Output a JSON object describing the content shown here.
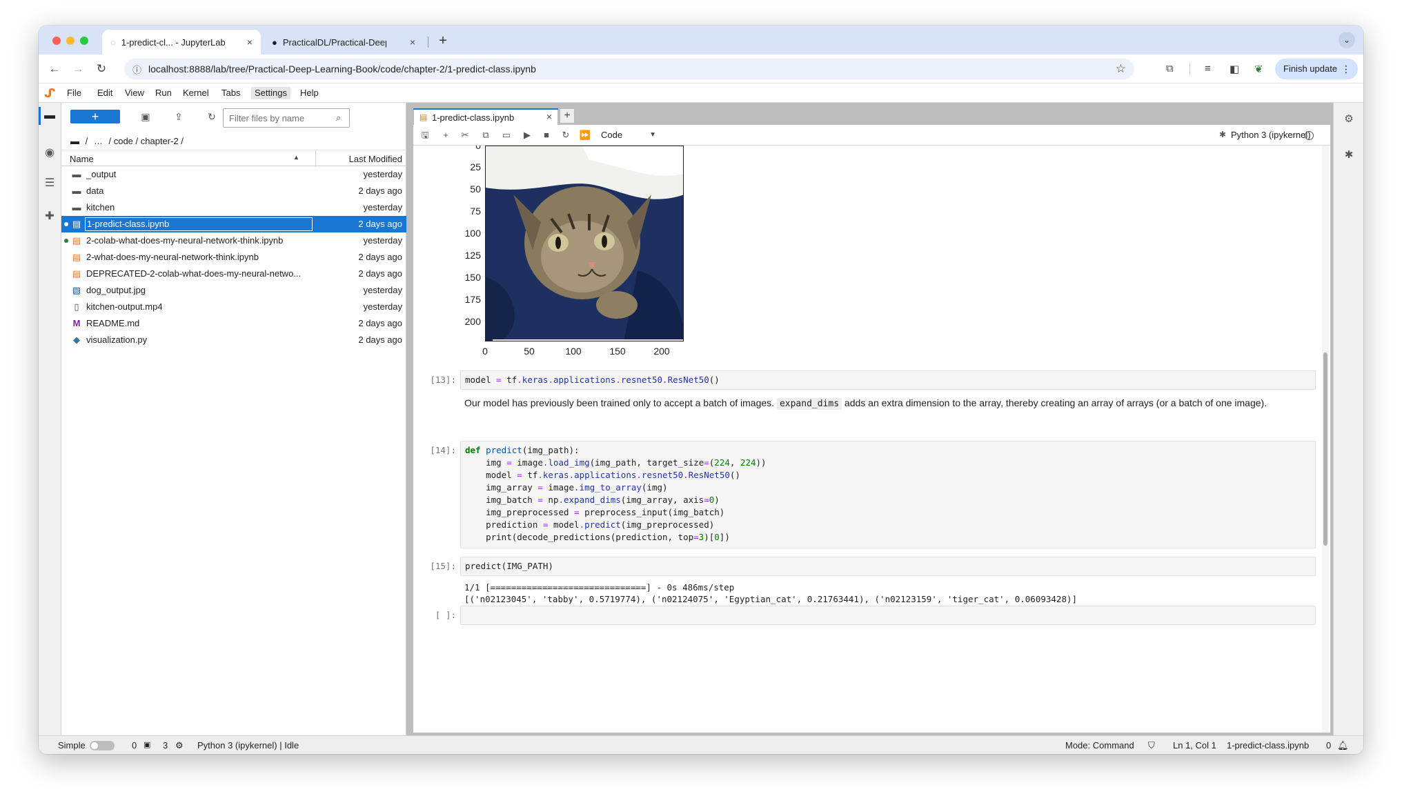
{
  "browser": {
    "tabs": [
      {
        "title": "1-predict-cl... - JupyterLab",
        "active": true
      },
      {
        "title": "PracticalDL/Practical-Deep-L",
        "active": false
      }
    ],
    "new_tab": "+",
    "tab_close": "×",
    "url": "localhost:8888/lab/tree/Practical-Deep-Learning-Book/code/chapter-2/1-predict-class.ipynb",
    "finish_update": "Finish update"
  },
  "menu": {
    "items": [
      "File",
      "Edit",
      "View",
      "Run",
      "Kernel",
      "Tabs",
      "Settings",
      "Help"
    ]
  },
  "filebrowser": {
    "new_label": "+",
    "filter_placeholder": "Filter files by name",
    "breadcrumb": [
      "/",
      "…",
      "/ code / chapter-2 /"
    ],
    "col_name": "Name",
    "col_modified": "Last Modified",
    "files": [
      {
        "name": "_output",
        "date": "yesterday",
        "icon": "folder"
      },
      {
        "name": "data",
        "date": "2 days ago",
        "icon": "folder"
      },
      {
        "name": "kitchen",
        "date": "yesterday",
        "icon": "folder"
      },
      {
        "name": "1-predict-class.ipynb",
        "date": "2 days ago",
        "icon": "notebook"
      },
      {
        "name": "2-colab-what-does-my-neural-network-think.ipynb",
        "date": "yesterday",
        "icon": "notebook"
      },
      {
        "name": "2-what-does-my-neural-network-think.ipynb",
        "date": "2 days ago",
        "icon": "notebook"
      },
      {
        "name": "DEPRECATED-2-colab-what-does-my-neural-netwo...",
        "date": "2 days ago",
        "icon": "notebook"
      },
      {
        "name": "dog_output.jpg",
        "date": "yesterday",
        "icon": "image"
      },
      {
        "name": "kitchen-output.mp4",
        "date": "yesterday",
        "icon": "file"
      },
      {
        "name": "README.md",
        "date": "2 days ago",
        "icon": "markdown"
      },
      {
        "name": "visualization.py",
        "date": "2 days ago",
        "icon": "python"
      }
    ]
  },
  "notebook": {
    "tab_title": "1-predict-class.ipynb",
    "cell_type": "Code",
    "kernel": "Python 3 (ipykernel)",
    "plot": {
      "yticks": [
        "0",
        "25",
        "50",
        "75",
        "100",
        "125",
        "150",
        "175",
        "200"
      ],
      "xticks": [
        "0",
        "50",
        "100",
        "150",
        "200"
      ]
    },
    "cells": {
      "c13_prompt": "[13]:",
      "c14_prompt": "[14]:",
      "c15_prompt": "[15]:",
      "empty_prompt": "[ ]:",
      "md_text_1": "Our model has previously been trained only to accept a batch of images.",
      "md_code": "expand_dims",
      "md_text_2": "adds an extra dimension to the array, thereby creating an array of arrays (or a batch of one image).",
      "c15_code": "predict(IMG_PATH)",
      "c15_out_1": "1/1 [==============================] - 0s 486ms/step",
      "c15_out_2": "[('n02123045', 'tabby', 0.5719774), ('n02124075', 'Egyptian_cat', 0.21763441), ('n02123159', 'tiger_cat', 0.06093428)]"
    }
  },
  "status": {
    "mode_label": "Simple",
    "count_a": "0",
    "count_b": "3",
    "kernel_status": "Python 3 (ipykernel) | Idle",
    "mode": "Mode: Command",
    "position": "Ln 1, Col 1",
    "file": "1-predict-class.ipynb",
    "notifications": "0"
  }
}
